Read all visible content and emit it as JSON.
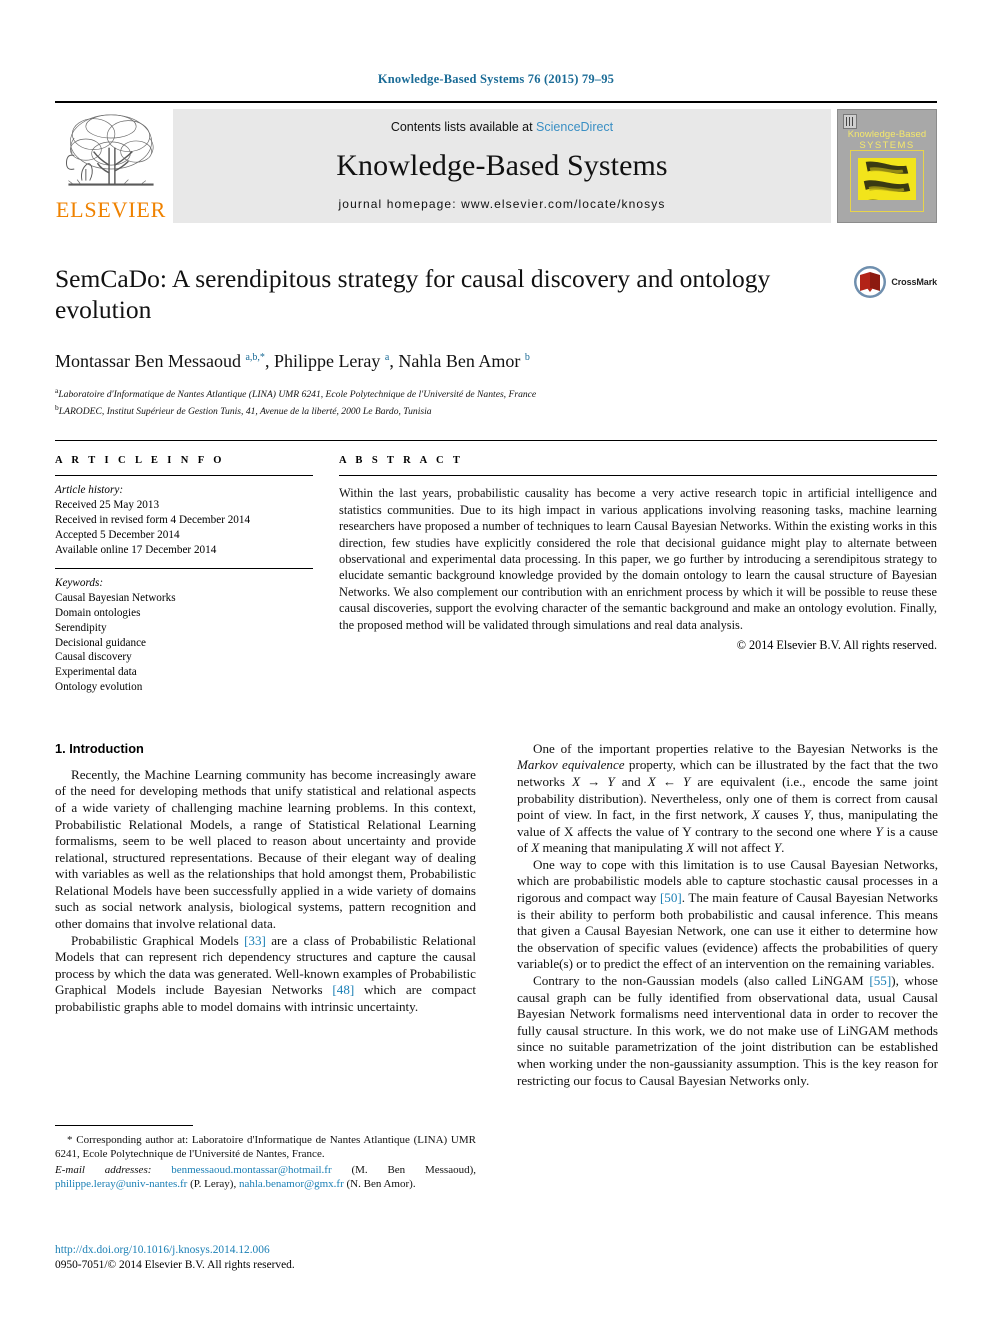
{
  "running_head": "Knowledge-Based Systems 76 (2015) 79–95",
  "masthead": {
    "publisher": "ELSEVIER",
    "contents_prefix": "Contents lists available at ",
    "contents_link": "ScienceDirect",
    "journal_name": "Knowledge-Based Systems",
    "homepage": "journal homepage: www.elsevier.com/locate/knosys",
    "cover_title_line1": "Knowledge-Based",
    "cover_title_line2": "SYSTEMS"
  },
  "article": {
    "title": "SemCaDo: A serendipitous strategy for causal discovery and ontology evolution",
    "crossmark_label": "CrossMark",
    "authors_html": "Montassar Ben Messaoud <sup>a,b,*</sup>, Philippe Leray <sup>a</sup>, Nahla Ben Amor <sup>b</sup>",
    "affiliation_a": "Laboratoire d'Informatique de Nantes Atlantique (LINA) UMR 6241, Ecole Polytechnique de l'Université de Nantes, France",
    "affiliation_b": "LARODEC, Institut Supérieur de Gestion Tunis, 41, Avenue de la liberté, 2000 Le Bardo, Tunisia"
  },
  "article_info": {
    "heading": "A R T I C L E   I N F O",
    "history_label": "Article history:",
    "history": [
      "Received 25 May 2013",
      "Received in revised form 4 December 2014",
      "Accepted 5 December 2014",
      "Available online 17 December 2014"
    ],
    "keywords_label": "Keywords:",
    "keywords": [
      "Causal Bayesian Networks",
      "Domain ontologies",
      "Serendipity",
      "Decisional guidance",
      "Causal discovery",
      "Experimental data",
      "Ontology evolution"
    ]
  },
  "abstract": {
    "heading": "A B S T R A C T",
    "text": "Within the last years, probabilistic causality has become a very active research topic in artificial intelligence and statistics communities. Due to its high impact in various applications involving reasoning tasks, machine learning researchers have proposed a number of techniques to learn Causal Bayesian Networks. Within the existing works in this direction, few studies have explicitly considered the role that decisional guidance might play to alternate between observational and experimental data processing. In this paper, we go further by introducing a serendipitous strategy to elucidate semantic background knowledge provided by the domain ontology to learn the causal structure of Bayesian Networks. We also complement our contribution with an enrichment process by which it will be possible to reuse these causal discoveries, support the evolving character of the semantic background and make an ontology evolution. Finally, the proposed method will be validated through simulations and real data analysis.",
    "copyright": "© 2014 Elsevier B.V. All rights reserved."
  },
  "body": {
    "section_title": "1. Introduction",
    "left_paragraphs": [
      "Recently, the Machine Learning community has become increasingly aware of the need for developing methods that unify statistical and relational aspects of a wide variety of challenging machine learning problems. In this context, Probabilistic Relational Models, a range of Statistical Relational Learning formalisms, seem to be well placed to reason about uncertainty and provide relational, structured representations. Because of their elegant way of dealing with variables as well as the relationships that hold amongst them, Probabilistic Relational Models have been successfully applied in a wide variety of domains such as social network analysis, biological systems, pattern recognition and other domains that involve relational data."
    ],
    "right_paragraphs": [
      "One way to cope with this limitation is to use Causal Bayesian Networks, which are probabilistic models able to capture stochastic causal processes in a rigorous and compact way [50]. The main feature of Causal Bayesian Networks is their ability to perform both probabilistic and causal inference. This means that given a Causal Bayesian Network, one can use it either to determine how the observation of specific values (evidence) affects the probabilities of query variable(s) or to predict the effect of an intervention on the remaining variables.",
      "Contrary to the non-Gaussian models (also called LiNGAM [55]), whose causal graph can be fully identified from observational data, usual Causal Bayesian Network formalisms need interventional data in order to recover the fully causal structure. In this work, we do not make use of LiNGAM methods since no suitable parametrization of the joint distribution can be established when working under the non-gaussianity assumption. This is the key reason for restricting our focus to Causal Bayesian Networks only."
    ]
  },
  "footnotes": {
    "corresponding": "* Corresponding author at: Laboratoire d'Informatique de Nantes Atlantique (LINA) UMR 6241, Ecole Polytechnique de l'Université de Nantes, France.",
    "email_label": "E-mail addresses:",
    "emails": [
      {
        "address": "benmessaoud.montassar@hotmail.fr",
        "name": "(M. Ben Messaoud)"
      },
      {
        "address": "philippe.leray@univ-nantes.fr",
        "name": "(P. Leray)"
      },
      {
        "address": "nahla.benamor@gmx.fr",
        "name": "(N. Ben Amor)"
      }
    ],
    "doi": "http://dx.doi.org/10.1016/j.knosys.2014.12.006",
    "issn_line": "0950-7051/© 2014 Elsevier B.V. All rights reserved."
  },
  "colors": {
    "link": "#1a7fb5",
    "running_head": "#1a6b96",
    "elsevier_orange": "#ef8200",
    "cover_yellow": "#f2e41b"
  }
}
